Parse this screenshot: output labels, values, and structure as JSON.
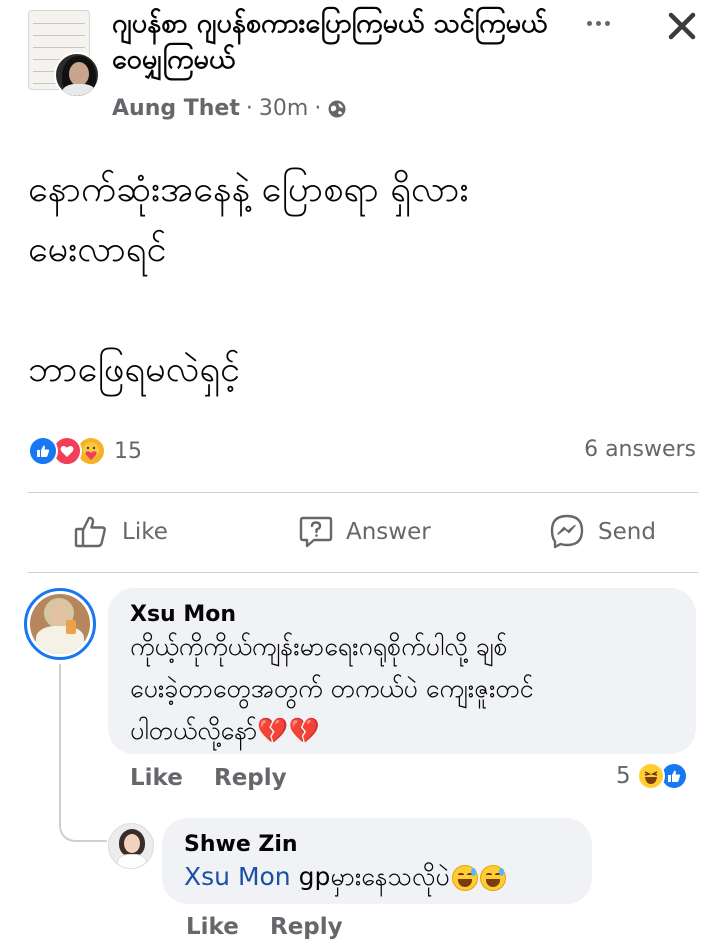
{
  "post": {
    "group_name": "ဂျပန်စာ ဂျပန်စကားပြောကြမယ် သင်ကြမယ် ဝေမျှကြမယ်",
    "author": "Aung Thet",
    "time": "30m",
    "separator": "·",
    "privacy_icon": "globe-icon",
    "text_lines": [
      "နောက်ဆုံးအနေနဲ့ ပြောစရာ ရှိလား",
      "မေးလာရင်",
      "ဘာဖြေရမလဲရှင့်"
    ],
    "reaction_icons": [
      "like-reaction-icon",
      "love-reaction-icon",
      "care-reaction-icon"
    ],
    "reaction_count": "15",
    "answers_count": "6 answers"
  },
  "actions": {
    "like_label": "Like",
    "answer_label": "Answer",
    "send_label": "Send"
  },
  "comments": [
    {
      "name": "Xsu Mon",
      "text_lines": [
        "ကိုယ့်ကိုကိုယ်ကျန်းမာရေးဂရုစိုက်ပါလို့ ချစ်",
        "ပေးခဲ့တာတွေအတွက် တကယ်ပဲ ကျေးဇူးတင်",
        "ပါတယ်လို့နော်"
      ],
      "trailing_emoji": "💔💔",
      "like_label": "Like",
      "reply_label": "Reply",
      "reaction_count": "5",
      "reaction_icons": [
        "haha-reaction-icon",
        "like-reaction-icon"
      ]
    },
    {
      "name": "Shwe Zin",
      "mention": "Xsu Mon",
      "text": " gpမှားနေသလိုပဲ",
      "like_label": "Like",
      "reply_label": "Reply"
    }
  ],
  "colors": {
    "facebook_blue": "#1877f2",
    "love_red": "#f33e58",
    "care_yellow": "#f7b125",
    "secondary_text": "#65676b",
    "bubble_bg": "#f0f2f5",
    "mention_blue": "#1c4fa8"
  }
}
